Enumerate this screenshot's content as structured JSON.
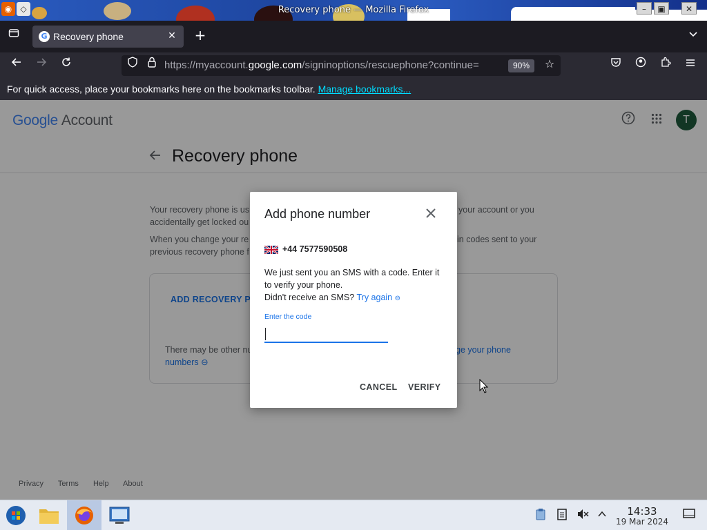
{
  "window": {
    "title": "Recovery phone — Mozilla Firefox"
  },
  "browser": {
    "tab_title": "Recovery phone",
    "url_prefix": "https://myaccount.",
    "url_host": "google.com",
    "url_path": "/signinoptions/rescuephone?continue=",
    "zoom": "90%",
    "bookmarks_hint": "For quick access, place your bookmarks here on the bookmarks toolbar.",
    "manage_bookmarks": "Manage bookmarks..."
  },
  "page": {
    "brand": "Google",
    "brand_suffix": "Account",
    "avatar_letter": "T",
    "title": "Recovery phone",
    "intro_visible": "Your recovery phone is us",
    "intro_right": "your account or you",
    "intro_line2": "accidentally get locked ou",
    "change_left": "When you change your re",
    "change_right": "in codes sent to your",
    "change_line2": "previous recovery phone f",
    "add_recovery": "ADD RECOVERY PHO",
    "note_left": "There may be other nu",
    "note_right": "ge your phone",
    "note_line2": "numbers",
    "footer": {
      "privacy": "Privacy",
      "terms": "Terms",
      "help": "Help",
      "about": "About"
    }
  },
  "dialog": {
    "title": "Add phone number",
    "country_flag": "uk-flag-icon",
    "phone": "+44 7577590508",
    "message": "We just sent you an SMS with a code. Enter it to verify your phone.",
    "resend_prompt": "Didn't receive an SMS?",
    "try_again": "Try again",
    "code_label": "Enter the code",
    "code_value": "",
    "cancel": "CANCEL",
    "verify": "VERIFY"
  },
  "taskbar": {
    "time": "14:33",
    "date": "19 Mar 2024"
  },
  "colors": {
    "accent": "#1a73e8",
    "chrome_dark": "#1c1b22",
    "avatar_bg": "#1e5a3c"
  }
}
